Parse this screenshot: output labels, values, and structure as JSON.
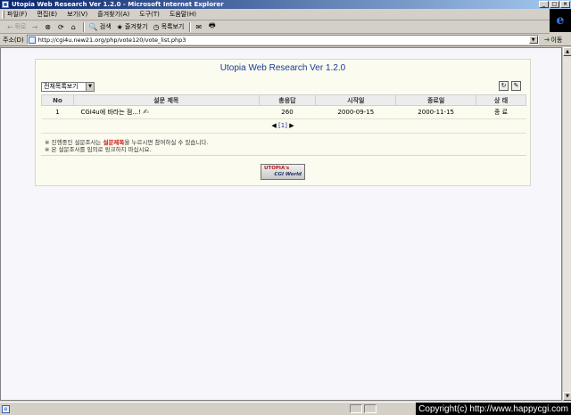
{
  "window": {
    "title": "Utopia Web Research Ver 1.2.0 - Microsoft Internet Explorer",
    "buttons": [
      "_",
      "□",
      "×"
    ]
  },
  "menu": [
    "파일(F)",
    "편집(E)",
    "보기(V)",
    "즐겨찾기(A)",
    "도구(T)",
    "도움말(H)"
  ],
  "toolbar": {
    "back": "뒤로",
    "forward": "→",
    "stop": "⊗",
    "refresh": "⟳",
    "home": "⌂",
    "search": "검색",
    "favorites": "즐겨찾기",
    "history": "목록보기",
    "mail": "✉",
    "print": "🖶"
  },
  "address": {
    "label": "주소(D)",
    "url": "http://cgi4u.new21.org/php/vote120/vote_list.php3",
    "go": "이동"
  },
  "panel": {
    "title": "Utopia Web Research Ver 1.2.0",
    "view_select": "전체목록보기",
    "columns": [
      "No",
      "설문 제목",
      "총응답",
      "시작일",
      "종료일",
      "상 태"
    ],
    "rows": [
      {
        "no": "1",
        "subject": "CGI4u에 바라는 점...!",
        "total": "260",
        "start": "2000-09-15",
        "end": "2000-11-15",
        "status": "종 료"
      }
    ],
    "pager": "[1]",
    "note1_prefix": "※ 진행중인 설문조사는 ",
    "note1_highlight": "설문제목",
    "note1_suffix": "을 누르시면 참여하실 수 있습니다.",
    "note2": "※ 본 설문조사를 임의로 링크하지 마십시요.",
    "badge_line1": "UTOPIA's",
    "badge_line2": "CGI World"
  },
  "status": {
    "copyright": "Copyright(c) http://www.happycgi.com"
  }
}
